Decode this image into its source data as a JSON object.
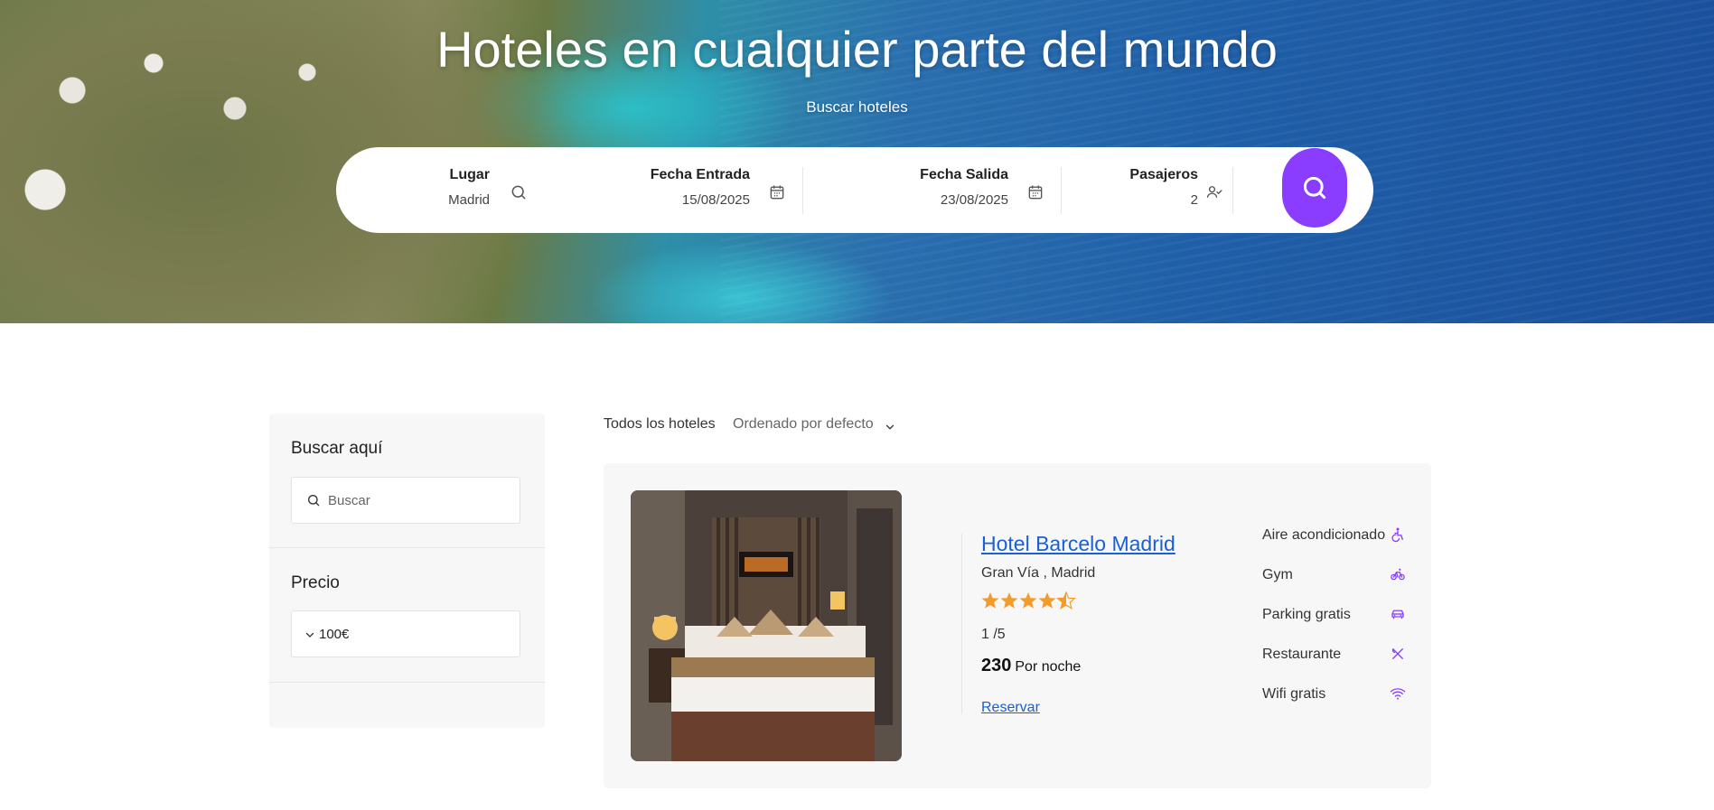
{
  "hero": {
    "title": "Hoteles en cualquier parte del mundo",
    "subtitle": "Buscar hoteles"
  },
  "search": {
    "place": {
      "label": "Lugar",
      "value": "Madrid",
      "icon": "search-icon"
    },
    "checkin": {
      "label": "Fecha Entrada",
      "value": "15/08/2025",
      "icon": "calendar-icon"
    },
    "checkout": {
      "label": "Fecha Salida",
      "value": "23/08/2025",
      "icon": "calendar-icon"
    },
    "guests": {
      "label": "Pasajeros",
      "value": "2",
      "icon": "user-check-icon"
    },
    "button_icon": "search-icon",
    "accent": "#8b3dff"
  },
  "sidebar": {
    "search_heading": "Buscar aquí",
    "search_placeholder": "Buscar",
    "price_heading": "Precio",
    "price_value": "100€"
  },
  "list": {
    "all_label": "Todos los hoteles",
    "sort_label": "Ordenado por defecto"
  },
  "hotel": {
    "name": "Hotel Barcelo Madrid",
    "location": "Gran Vía , Madrid",
    "stars": 4.5,
    "rating": "1 /5",
    "price": "230",
    "price_unit": "Por noche",
    "reserve_label": "Reservar",
    "star_color": "#f39c2c",
    "amenities": [
      {
        "label": "Aire acondicionado",
        "icon": "accessibility-icon"
      },
      {
        "label": "Gym",
        "icon": "bike-icon"
      },
      {
        "label": "Parking gratis",
        "icon": "car-icon"
      },
      {
        "label": "Restaurante",
        "icon": "utensils-icon"
      },
      {
        "label": "Wifi gratis",
        "icon": "wifi-icon"
      }
    ]
  }
}
